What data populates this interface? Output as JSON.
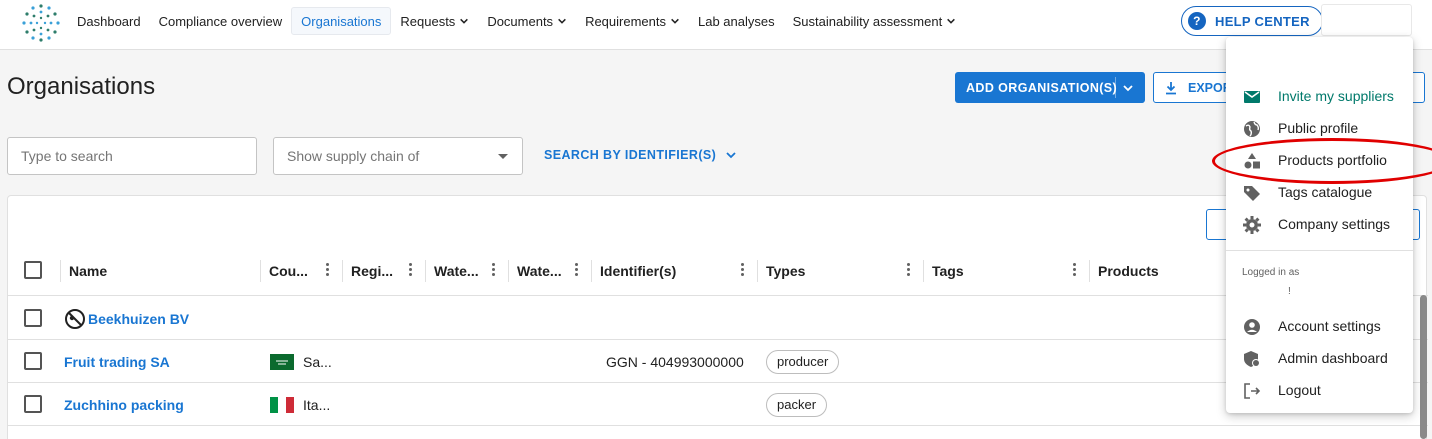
{
  "nav": {
    "items": [
      {
        "label": "Dashboard",
        "dropdown": false,
        "active": false
      },
      {
        "label": "Compliance overview",
        "dropdown": false,
        "active": false
      },
      {
        "label": "Organisations",
        "dropdown": false,
        "active": true
      },
      {
        "label": "Requests",
        "dropdown": true,
        "active": false
      },
      {
        "label": "Documents",
        "dropdown": true,
        "active": false
      },
      {
        "label": "Requirements",
        "dropdown": true,
        "active": false
      },
      {
        "label": "Lab analyses",
        "dropdown": false,
        "active": false
      },
      {
        "label": "Sustainability assessment",
        "dropdown": true,
        "active": false
      }
    ],
    "help_label": "HELP CENTER",
    "help_icon": "help-circle-icon"
  },
  "page": {
    "title": "Organisations",
    "add_button": "ADD ORGANISATION(S)",
    "export_button": "EXPOR",
    "search_placeholder": "Type to search",
    "supply_chain_placeholder": "Show supply chain of",
    "search_identifier": "SEARCH BY IDENTIFIER(S)"
  },
  "table": {
    "columns": [
      "Name",
      "Cou...",
      "Regi...",
      "Wate...",
      "Wate...",
      "Identifier(s)",
      "Types",
      "Tags",
      "Products"
    ],
    "rows": [
      {
        "name": "Beekhuizen BV",
        "country": "",
        "flag": "",
        "identifier": "",
        "type": "",
        "icon": "blocked-icon"
      },
      {
        "name": "Fruit trading SA",
        "country": "Sa...",
        "flag": "saudi-arabia",
        "identifier": "GGN - 404993000000",
        "type": "producer",
        "icon": ""
      },
      {
        "name": "Zuchhino packing",
        "country": "Ita...",
        "flag": "italy",
        "identifier": "",
        "type": "packer",
        "icon": ""
      }
    ]
  },
  "menu": {
    "items": [
      {
        "label": "Invite my suppliers",
        "icon": "mail-icon",
        "highlight": true
      },
      {
        "label": "Public profile",
        "icon": "globe-icon",
        "highlight": false
      },
      {
        "label": "Products portfolio",
        "icon": "shapes-icon",
        "highlight": false
      },
      {
        "label": "Tags catalogue",
        "icon": "tag-icon",
        "highlight": false
      },
      {
        "label": "Company settings",
        "icon": "gear-icon",
        "highlight": false
      }
    ],
    "logged_in_label": "Logged in as",
    "logged_in_user": "!",
    "account_items": [
      {
        "label": "Account settings",
        "icon": "account-circle-icon"
      },
      {
        "label": "Admin dashboard",
        "icon": "admin-shield-icon"
      },
      {
        "label": "Logout",
        "icon": "logout-icon"
      }
    ]
  },
  "colors": {
    "primary": "#1976d2",
    "accent_green": "#00796b",
    "annotation_red": "#e00000"
  }
}
